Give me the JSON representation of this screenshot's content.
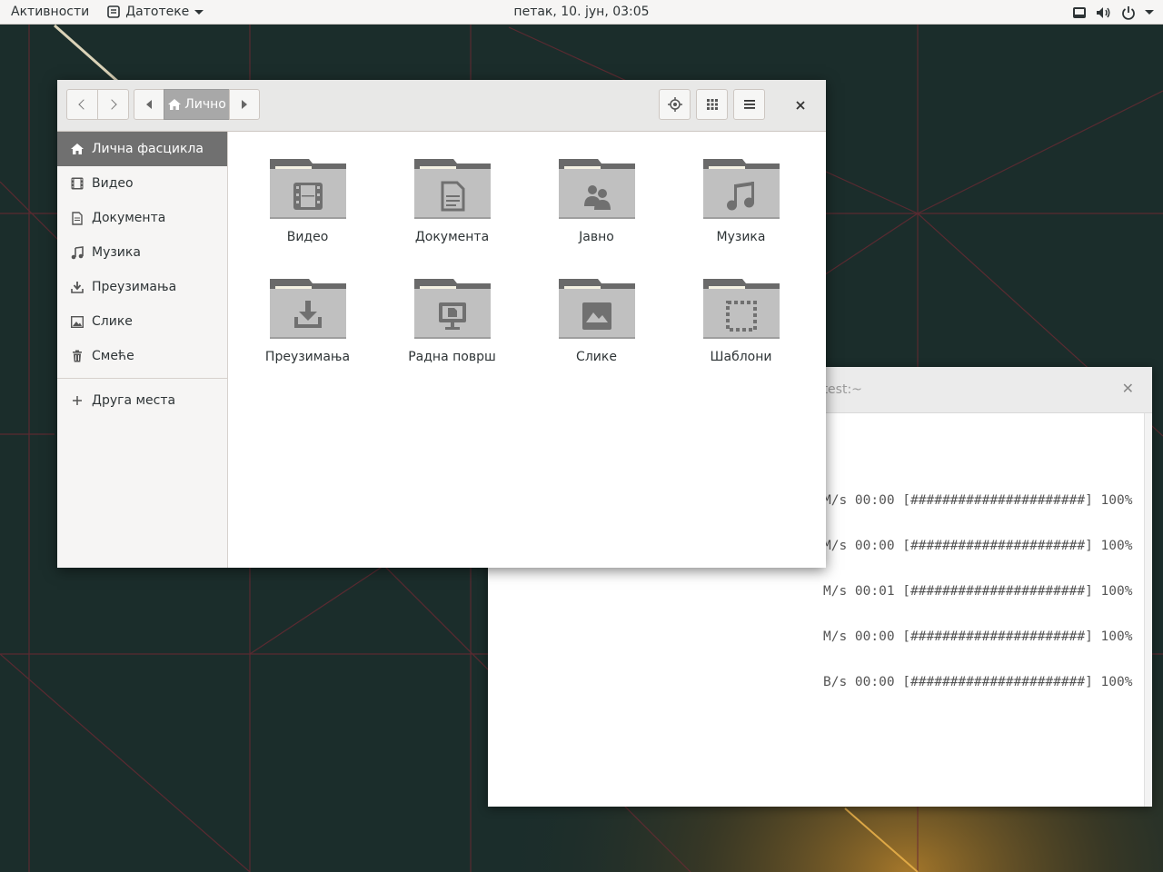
{
  "topbar": {
    "activities": "Активности",
    "app_menu": "Датотеке",
    "clock": "петак, 10. јун, 03:05",
    "tray_icons": [
      "network-icon",
      "volume-icon",
      "power-icon"
    ]
  },
  "terminal": {
    "title": "otest:~",
    "lines": [
      "M/s 00:00 [######################] 100%",
      "M/s 00:00 [######################] 100%",
      "M/s 00:01 [######################] 100%",
      "M/s 00:00 [######################] 100%",
      "B/s 00:00 [######################] 100%"
    ]
  },
  "files": {
    "path_current": "Лично",
    "sidebar": [
      {
        "label": "Лична фасцикла",
        "icon": "home-icon",
        "active": true
      },
      {
        "label": "Видео",
        "icon": "film-icon"
      },
      {
        "label": "Документа",
        "icon": "document-icon"
      },
      {
        "label": "Музика",
        "icon": "music-icon"
      },
      {
        "label": "Преузимања",
        "icon": "download-icon"
      },
      {
        "label": "Слике",
        "icon": "image-icon"
      },
      {
        "label": "Смеће",
        "icon": "trash-icon"
      }
    ],
    "other_places": "Друга места",
    "folders": [
      {
        "label": "Видео",
        "icon": "film-icon"
      },
      {
        "label": "Документа",
        "icon": "document-icon"
      },
      {
        "label": "Јавно",
        "icon": "people-icon"
      },
      {
        "label": "Музика",
        "icon": "music-icon"
      },
      {
        "label": "Преузимања",
        "icon": "download-icon"
      },
      {
        "label": "Радна површ",
        "icon": "desktop-icon"
      },
      {
        "label": "Слике",
        "icon": "image-icon"
      },
      {
        "label": "Шаблони",
        "icon": "template-icon"
      }
    ]
  },
  "colors": {
    "accent_sidebar_active": "#707070",
    "folder_body": "#c0c0c0",
    "folder_tab": "#6a6a6a"
  }
}
